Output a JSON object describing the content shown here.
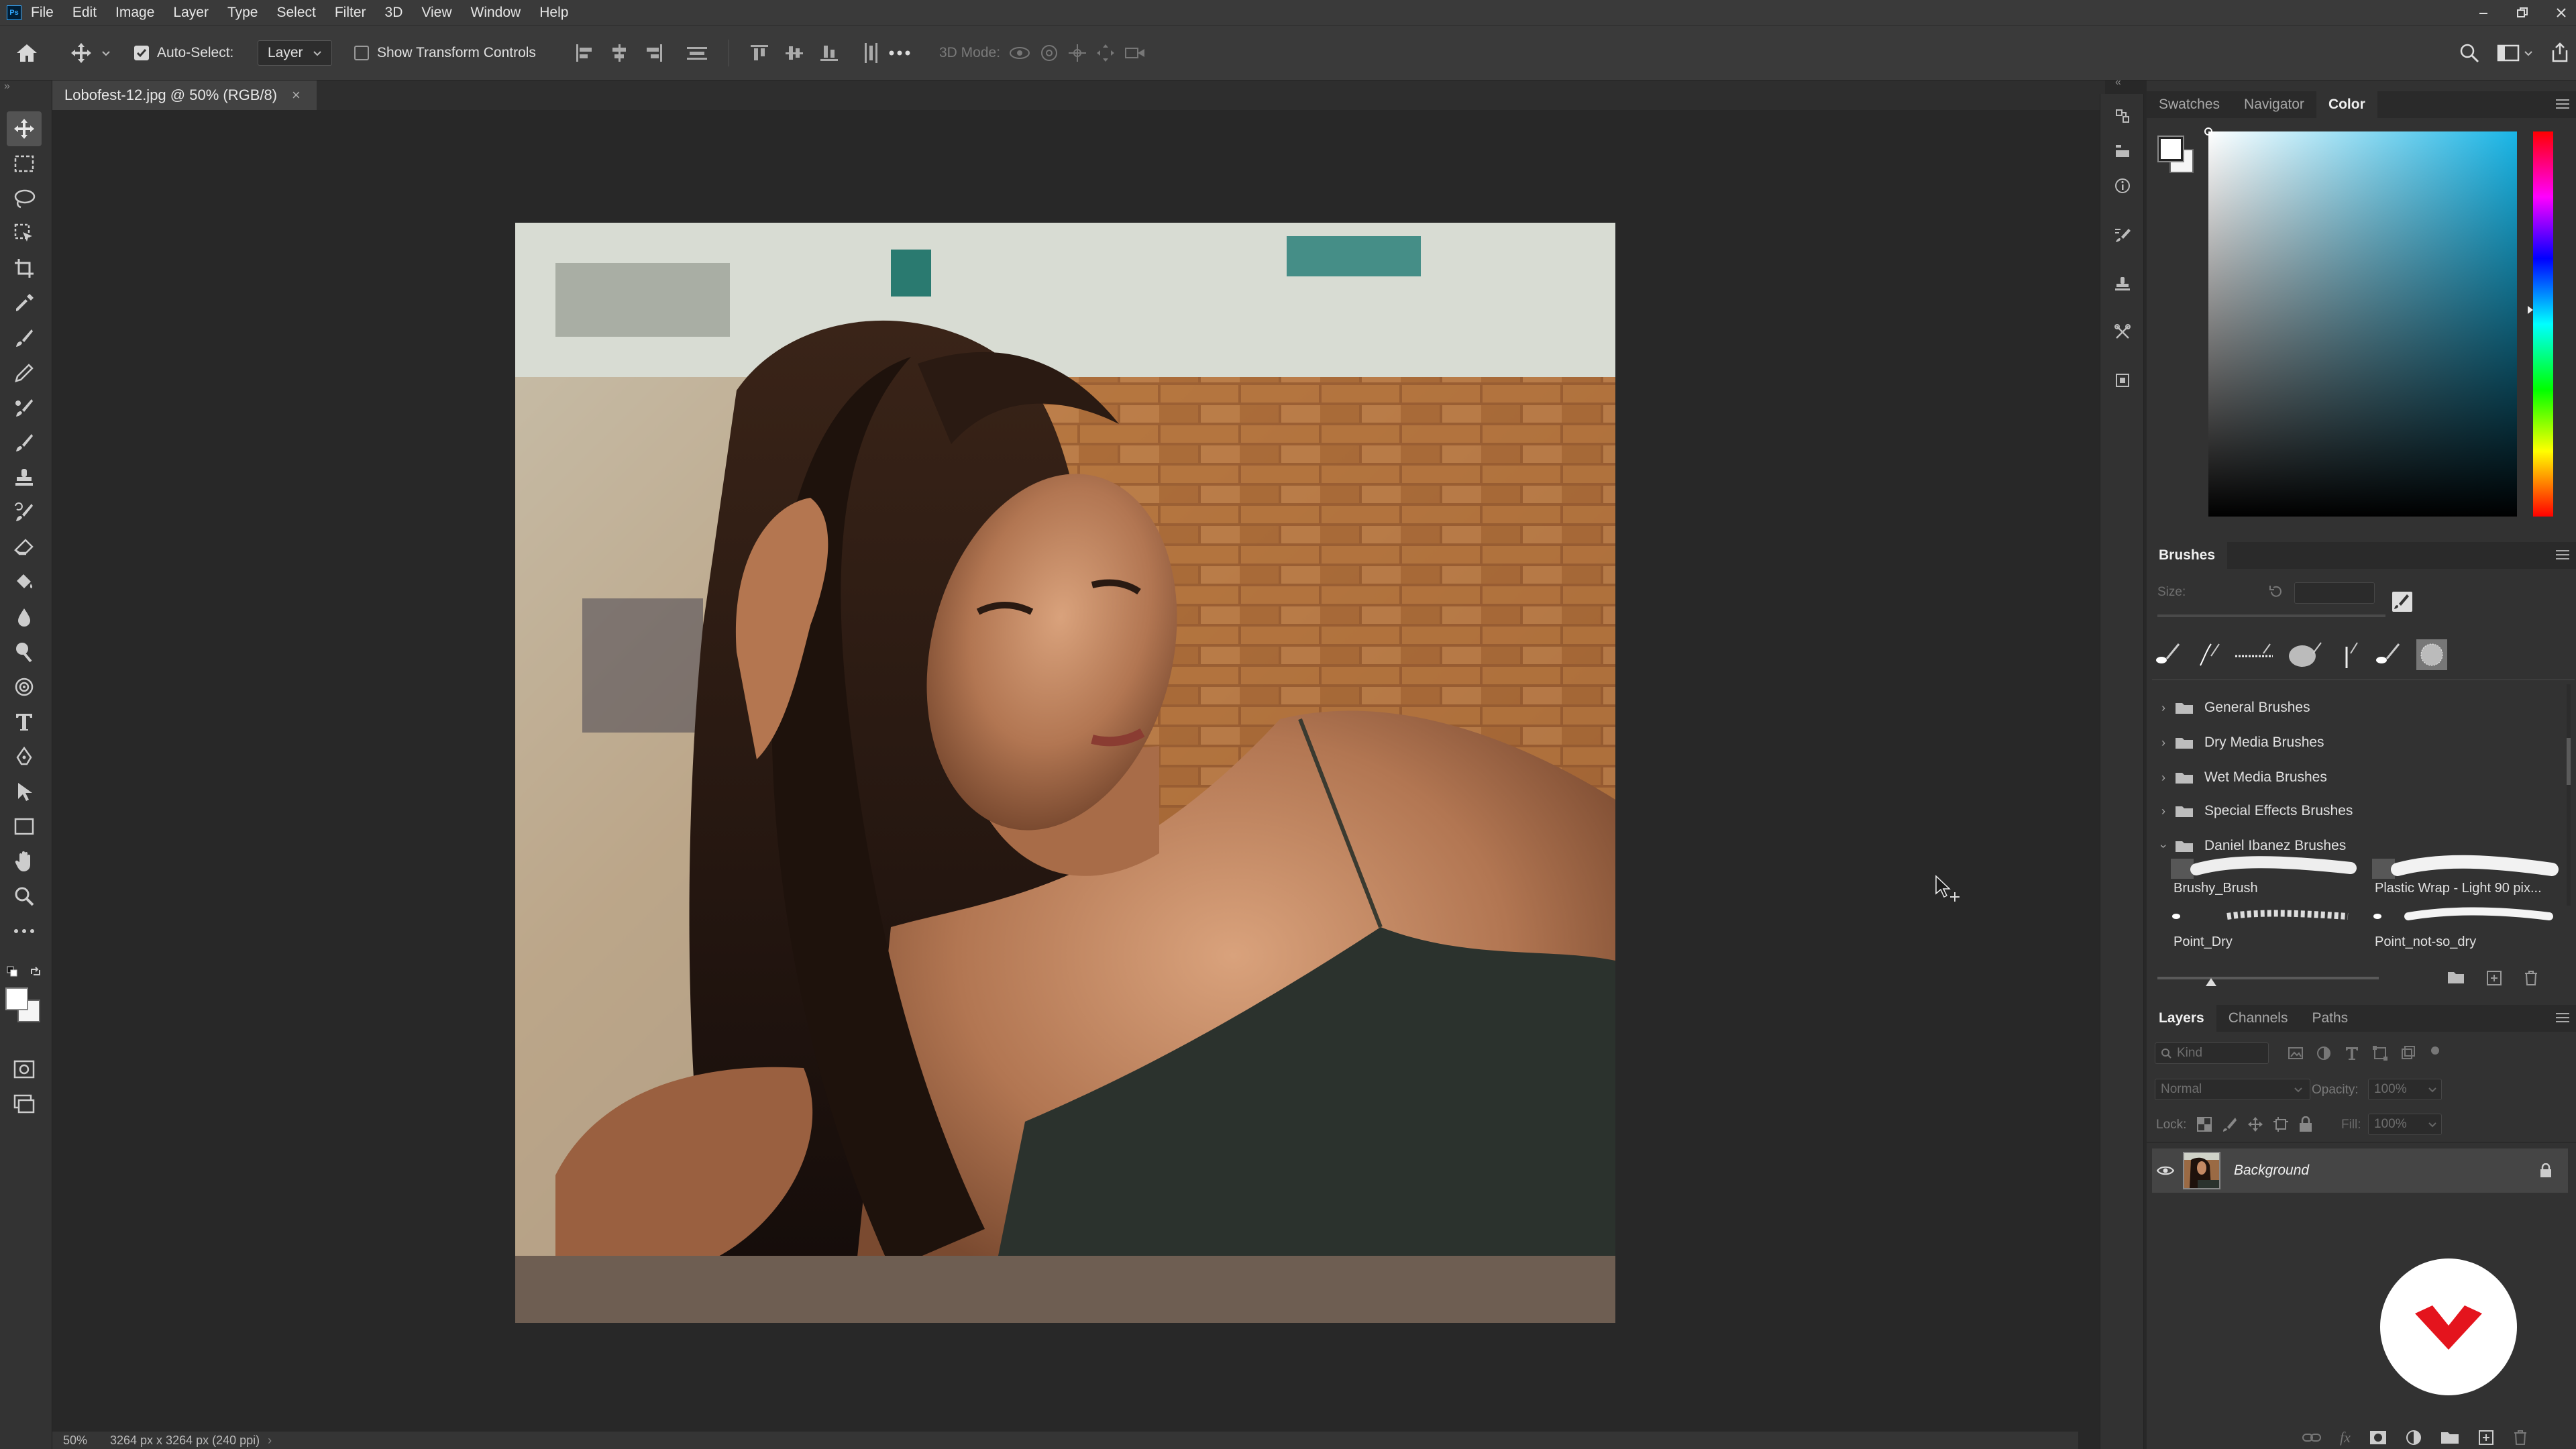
{
  "app": {
    "menu": [
      "File",
      "Edit",
      "Image",
      "Layer",
      "Type",
      "Select",
      "Filter",
      "3D",
      "View",
      "Window",
      "Help"
    ],
    "logo_text": "Ps"
  },
  "options_bar": {
    "auto_select_label": "Auto-Select:",
    "auto_select_checked": true,
    "auto_select_target": "Layer",
    "show_transform_label": "Show Transform Controls",
    "show_transform_checked": false,
    "mode_3d_label": "3D Mode:"
  },
  "document": {
    "tab_title": "Lobofest-12.jpg @ 50% (RGB/8)",
    "close_glyph": "×",
    "zoom": "50%",
    "dimensions": "3264 px x 3264 px (240 ppi)"
  },
  "color_panel": {
    "tabs": [
      "Swatches",
      "Navigator",
      "Color"
    ],
    "active_tab": "Color",
    "hue_color": "#19b5e6"
  },
  "brushes_panel": {
    "title": "Brushes",
    "size_label": "Size:",
    "folders": [
      {
        "name": "General Brushes",
        "expanded": false
      },
      {
        "name": "Dry Media Brushes",
        "expanded": false
      },
      {
        "name": "Wet Media Brushes",
        "expanded": false
      },
      {
        "name": "Special Effects Brushes",
        "expanded": false
      },
      {
        "name": "Daniel Ibanez Brushes",
        "expanded": true
      }
    ],
    "brushes": [
      "Brushy_Brush",
      "Plastic Wrap - Light 90 pix...",
      "Point_Dry",
      "Point_not-so_dry"
    ]
  },
  "layers_panel": {
    "tabs": [
      "Layers",
      "Channels",
      "Paths"
    ],
    "active_tab": "Layers",
    "filter_placeholder": "Kind",
    "blend_mode": "Normal",
    "opacity_label": "Opacity:",
    "opacity_value": "100%",
    "lock_label": "Lock:",
    "fill_label": "Fill:",
    "fill_value": "100%",
    "layers": [
      {
        "name": "Background",
        "visible": true,
        "locked": true
      }
    ]
  },
  "colors": {
    "accent": "#31a8ff",
    "badge_red": "#e4141d"
  }
}
